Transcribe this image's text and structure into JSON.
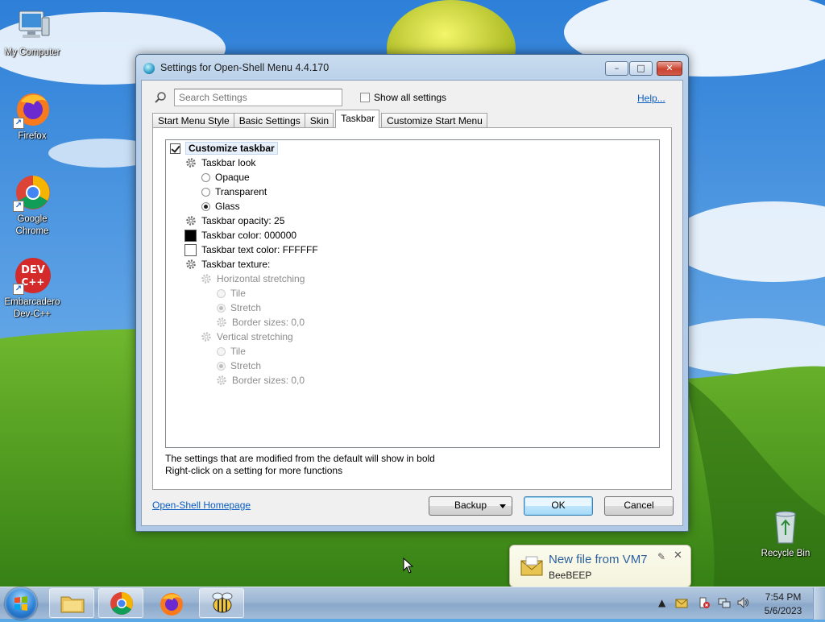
{
  "desktop": {
    "icons": [
      {
        "label": "My Computer"
      },
      {
        "label": "Firefox"
      },
      {
        "label": "Google Chrome",
        "line1": "Google",
        "line2": "Chrome"
      },
      {
        "label": "Embarcadero Dev-C++",
        "line1": "Embarcadero",
        "line2": "Dev-C++",
        "glyph": "DEV\nC++"
      },
      {
        "label": "Recycle Bin"
      }
    ]
  },
  "dialog": {
    "title": "Settings for Open-Shell Menu 4.4.170",
    "controls": {
      "minimize": "–",
      "maximize": "□",
      "close": "✕"
    },
    "search_placeholder": "Search Settings",
    "show_all_label": "Show all settings",
    "show_all_checked": false,
    "help_label": "Help...",
    "tabs": [
      {
        "label": "Start Menu Style",
        "active": false
      },
      {
        "label": "Basic Settings",
        "active": false
      },
      {
        "label": "Skin",
        "active": false
      },
      {
        "label": "Taskbar",
        "active": true
      },
      {
        "label": "Customize Start Menu",
        "active": false
      }
    ],
    "tree": {
      "customize_taskbar": "Customize taskbar",
      "taskbar_look": "Taskbar look",
      "opaque": "Opaque",
      "transparent": "Transparent",
      "glass": "Glass",
      "selected_look": "Glass",
      "taskbar_opacity": "Taskbar opacity: 25",
      "taskbar_color": "Taskbar color: 000000",
      "taskbar_color_hex": "#000000",
      "taskbar_text_color": "Taskbar text color: FFFFFF",
      "taskbar_text_color_hex": "#FFFFFF",
      "taskbar_texture": "Taskbar texture:",
      "horizontal_stretching": "Horizontal stretching",
      "h_tile": "Tile",
      "h_stretch": "Stretch",
      "h_border_sizes": "Border sizes: 0,0",
      "vertical_stretching": "Vertical stretching",
      "v_tile": "Tile",
      "v_stretch": "Stretch",
      "v_border_sizes": "Border sizes: 0,0"
    },
    "hint_line1": "The settings that are modified from the default will show in bold",
    "hint_line2": "Right-click on a setting for more functions",
    "homepage_link": "Open-Shell Homepage",
    "buttons": {
      "backup": "Backup",
      "ok": "OK",
      "cancel": "Cancel"
    }
  },
  "notification": {
    "title": "New file from VM7",
    "body": "BeeBEEP"
  },
  "taskbar": {
    "apps": [
      "explorer",
      "chrome",
      "firefox",
      "beebeep"
    ],
    "time": "7:54 PM",
    "date": "5/6/2023"
  }
}
